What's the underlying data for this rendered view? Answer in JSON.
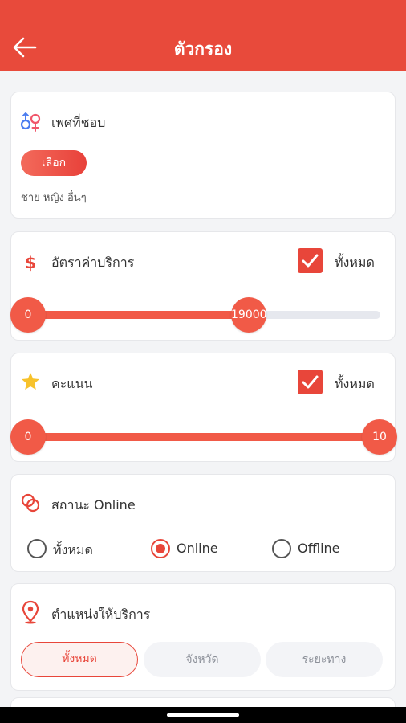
{
  "header": {
    "title": "ตัวกรอง",
    "back_icon": "arrow-left-icon"
  },
  "gender": {
    "title": "เพศที่ชอบ",
    "icon": "gender-icon",
    "select_label": "เลือก",
    "selected_text": "ชาย หญิง อื่นๆ"
  },
  "price": {
    "title": "อัตราค่าบริการ",
    "icon": "dollar-icon",
    "all_label": "ทั้งหมด",
    "all_checked": true,
    "slider_min_label": "0",
    "slider_max_label": "19000",
    "slider_fill_fraction": 0.63
  },
  "rating": {
    "title": "คะแนน",
    "icon": "star-icon",
    "all_label": "ทั้งหมด",
    "all_checked": true,
    "slider_min_label": "0",
    "slider_max_label": "10",
    "slider_fill_fraction": 1.0
  },
  "status": {
    "title": "สถานะ Online",
    "icon": "online-status-icon",
    "options": [
      {
        "label": "ทั้งหมด",
        "selected": false
      },
      {
        "label": "Online",
        "selected": true
      },
      {
        "label": "Offline",
        "selected": false
      }
    ]
  },
  "location": {
    "title": "ตำแหน่งให้บริการ",
    "icon": "location-pin-icon",
    "segments": [
      {
        "label": "ทั้งหมด",
        "active": true
      },
      {
        "label": "จังหวัด",
        "active": false
      },
      {
        "label": "ระยะทาง",
        "active": false
      }
    ]
  },
  "colors": {
    "primary": "#e84a3b",
    "track": "#f15a47",
    "track_bg": "#e6e8ee"
  }
}
